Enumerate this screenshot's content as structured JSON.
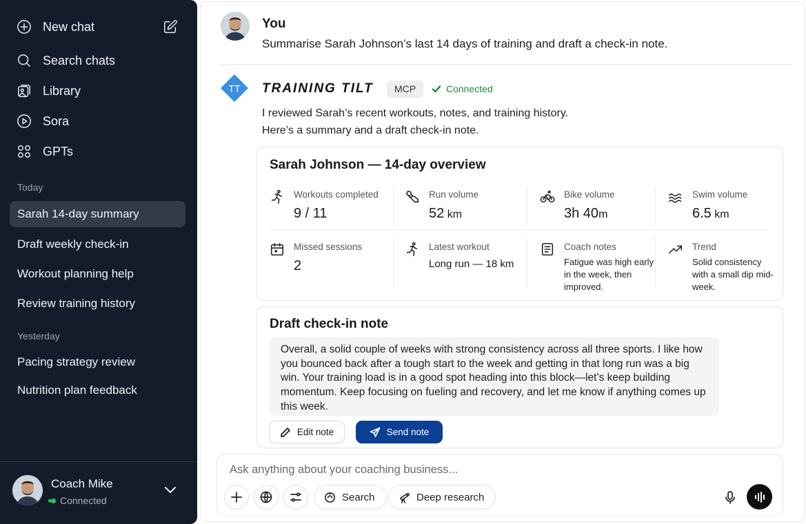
{
  "sidebar": {
    "nav": [
      {
        "label": "New chat",
        "icon": "plus-circle-icon"
      },
      {
        "label": "Search chats",
        "icon": "search-icon"
      },
      {
        "label": "Library",
        "icon": "library-icon"
      },
      {
        "label": "Sora",
        "icon": "play-circle-icon"
      },
      {
        "label": "GPTs",
        "icon": "grid-icon"
      }
    ],
    "new_chat_edit_icon": "edit-icon",
    "sections": {
      "today": "Today",
      "yesterday": "Yesterday"
    },
    "today_chats": [
      "Sarah 14-day summary",
      "Draft weekly check-in",
      "Workout planning help",
      "Review training history"
    ],
    "yesterday_chats": [
      "Pacing strategy review",
      "Nutrition plan feedback"
    ],
    "user": {
      "name": "Coach Mike",
      "status": "Connected",
      "status_color": "#2fbf5b"
    }
  },
  "conversation": {
    "user_message": {
      "author": "You",
      "text": "Summarise Sarah Johnson’s last 14 days of training and draft a check-in note."
    },
    "assistant": {
      "logo_text": "TT",
      "logo_color": "#3b8fe0",
      "name": "TRAINING TILT",
      "badge": "MCP",
      "status": "Connected",
      "status_color": "#1f8a3c",
      "intro_line1": "I reviewed Sarah’s recent workouts, notes, and training history.",
      "intro_line2": "Here’s a summary and a draft check-in note."
    },
    "overview": {
      "title": "Sarah Johnson — 14-day overview",
      "stats": [
        {
          "label": "Workouts completed",
          "value": "9 / 11",
          "unit": "",
          "icon": "running-icon"
        },
        {
          "label": "Run volume",
          "value": "52",
          "unit": " km",
          "icon": "shoe-icon"
        },
        {
          "label": "Bike volume",
          "value": "3h 40",
          "unit": "m",
          "icon": "bike-icon"
        },
        {
          "label": "Swim volume",
          "value": "6.5",
          "unit": " km",
          "icon": "waves-icon"
        },
        {
          "label": "Missed sessions",
          "value": "2",
          "unit": "",
          "icon": "calendar-icon"
        },
        {
          "label": "Latest workout",
          "value": "Long run — 18 km",
          "unit": "",
          "icon": "running-icon"
        },
        {
          "label": "Coach notes",
          "value": "Fatigue was high early in the week, then improved.",
          "unit": "",
          "icon": "notes-icon"
        },
        {
          "label": "Trend",
          "value": "Solid consistency with a small dip mid-week.",
          "unit": "",
          "icon": "trend-up-icon"
        }
      ]
    },
    "draft": {
      "title": "Draft check-in note",
      "text": "Overall, a solid couple of weeks with strong consistency across all three sports. I like how you bounced back after a tough start to the week and getting in that long run was a big win. Your training load is in a good spot heading into this block—let’s keep building momentum. Keep focusing on fueling and recovery, and let me know if anything comes up this week.",
      "edit_label": "Edit note",
      "send_label": "Send note",
      "send_color": "#0b3f94"
    }
  },
  "composer": {
    "placeholder": "Ask anything about your coaching business...",
    "search_label": "Search",
    "deep_research_label": "Deep research"
  }
}
